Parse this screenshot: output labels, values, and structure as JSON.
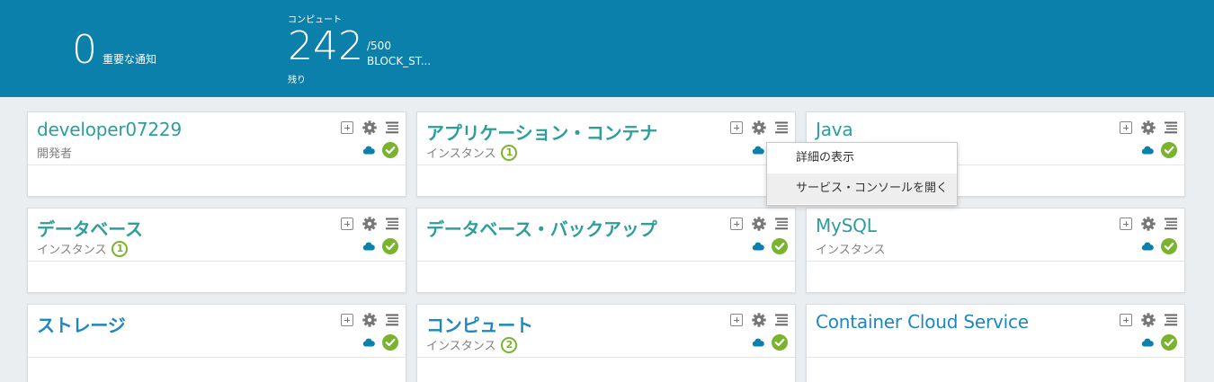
{
  "header": {
    "alerts_count": "0",
    "alerts_label": "重要な通知",
    "compute_caption": "コンピュート",
    "compute_value": "242",
    "compute_total": "/500",
    "compute_service": "BLOCK_ST...",
    "compute_remaining_label": "残り"
  },
  "cards": [
    {
      "title": "developer07229",
      "subtitle": "開発者",
      "count": ""
    },
    {
      "title": "アプリケーション・コンテナ",
      "subtitle": "インスタンス",
      "count": "1"
    },
    {
      "title": "Java",
      "subtitle": "",
      "count": ""
    },
    {
      "title": "データベース",
      "subtitle": "インスタンス",
      "count": "1"
    },
    {
      "title": "データベース・バックアップ",
      "subtitle": "",
      "count": ""
    },
    {
      "title": "MySQL",
      "subtitle": "インスタンス",
      "count": ""
    },
    {
      "title": "ストレージ",
      "subtitle": "",
      "count": ""
    },
    {
      "title": "コンピュート",
      "subtitle": "インスタンス",
      "count": "2"
    },
    {
      "title": "Container Cloud Service",
      "subtitle": "",
      "count": ""
    }
  ],
  "menu": {
    "items": [
      "詳細の表示",
      "サービス・コンソールを開く"
    ]
  },
  "icons": [
    "add-icon",
    "gear-icon",
    "menu-icon",
    "cloud-icon",
    "check-circle-icon"
  ],
  "colors": {
    "header_bg": "#0a80aa",
    "title_teal": "#2d9e9b",
    "title_blue": "#1c87c0",
    "status_green": "#7ab32d",
    "cloud_blue": "#0a80aa"
  }
}
